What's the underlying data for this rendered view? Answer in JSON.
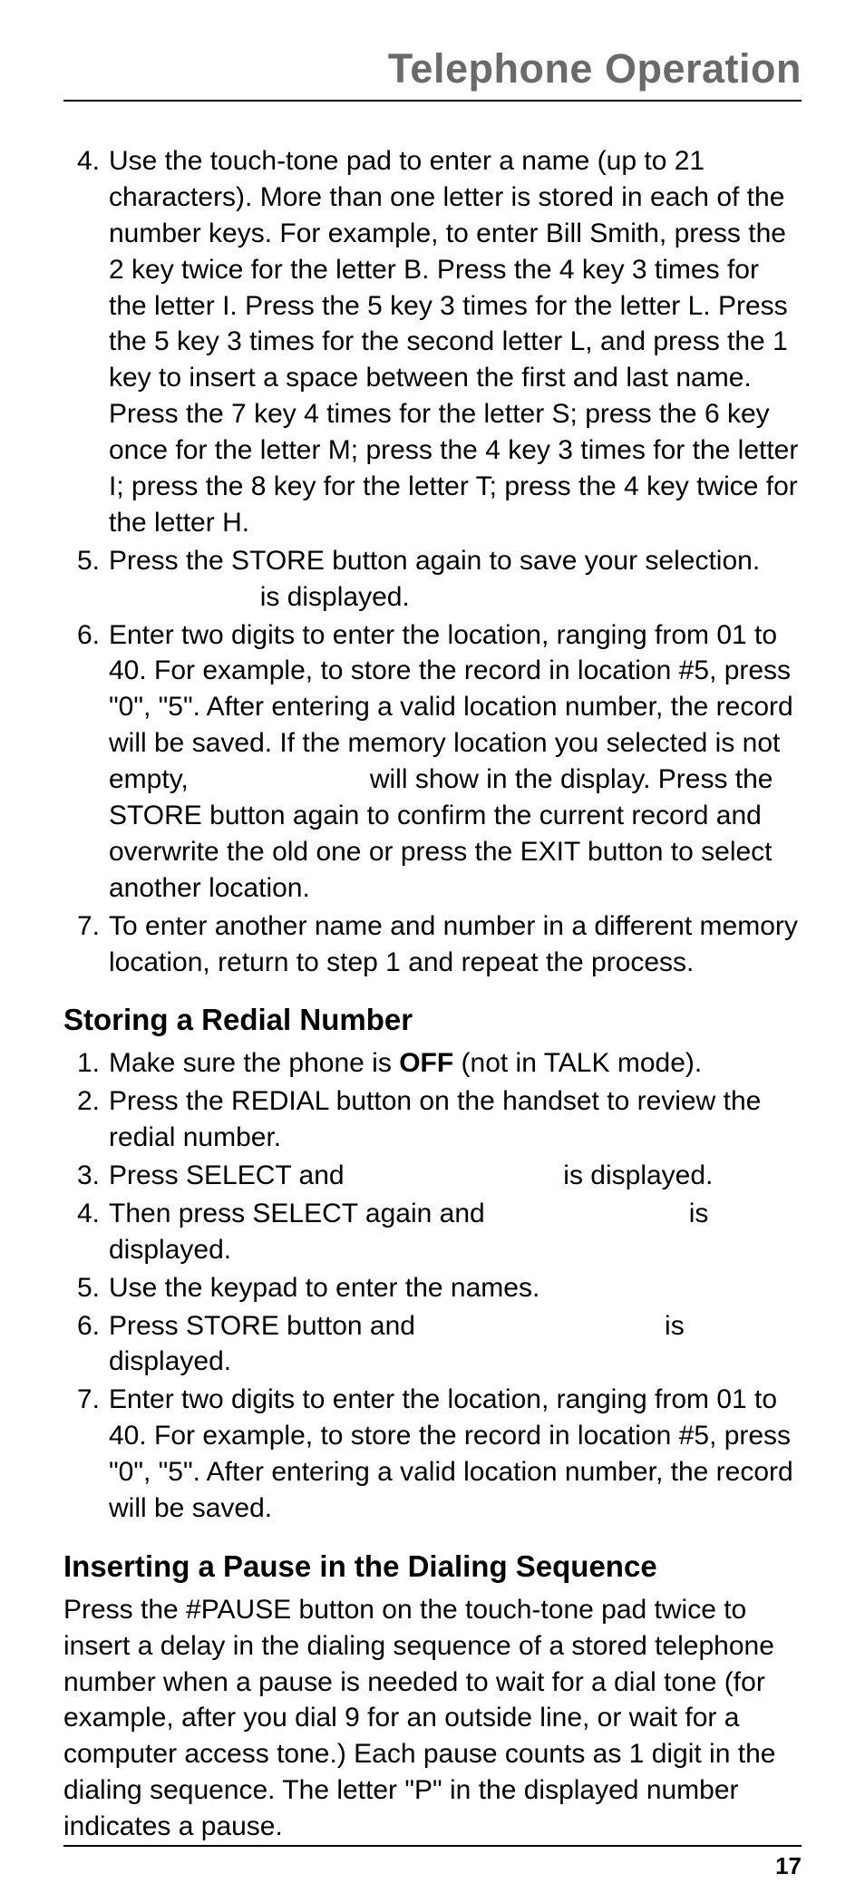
{
  "header": {
    "title": "Telephone Operation"
  },
  "section1": {
    "items": [
      {
        "num": "4.",
        "text": "Use the touch-tone pad to enter a name (up to 21 characters). More than one letter is stored in each of the number keys. For example, to enter Bill Smith, press the 2 key twice for the letter B. Press the 4 key 3 times for the letter I. Press the 5 key 3 times for the letter L. Press the 5 key 3 times for the second letter L, and press the 1 key to insert a space between the first and last name. Press the 7 key 4 times for the letter S; press the 6 key once for the letter M; press the 4 key 3 times for the letter I; press the 8 key for the letter T; press the 4 key twice for the letter H."
      },
      {
        "num": "5.",
        "text_a": "Press the STORE button again to save your selection. ",
        "text_b": " is displayed."
      },
      {
        "num": "6.",
        "text_a": "Enter two digits to enter the location, ranging from 01 to 40. For example, to store the record in location #5, press \"0\", \"5\". After entering a valid location number, the record will be saved. If the memory location you selected is not empty, ",
        "text_b": " will show in the display. Press the STORE button again to confirm the current record and overwrite the old one or press the EXIT button to select another location."
      },
      {
        "num": "7.",
        "text": "To enter another name and number in a different memory location, return to step 1 and repeat the process."
      }
    ]
  },
  "section2": {
    "heading": "Storing a Redial Number",
    "items": [
      {
        "num": "1.",
        "text_a": "Make sure the phone is ",
        "bold": "OFF",
        "text_b": " (not in TALK mode)."
      },
      {
        "num": "2.",
        "text": "Press the REDIAL button on the handset to review the redial number."
      },
      {
        "num": "3.",
        "text_a": "Press SELECT and ",
        "text_b": " is displayed."
      },
      {
        "num": "4.",
        "text_a": "Then press SELECT again and ",
        "text_b": " is displayed."
      },
      {
        "num": "5.",
        "text": "Use the keypad to enter the names."
      },
      {
        "num": "6.",
        "text_a": "Press STORE button and ",
        "text_b": " is displayed."
      },
      {
        "num": "7.",
        "text": "Enter two digits to enter the location, ranging from 01 to 40. For example, to store the record in location #5, press \"0\", \"5\". After entering a valid location number, the record will be saved."
      }
    ]
  },
  "section3": {
    "heading": "Inserting a Pause in the Dialing Sequence",
    "para": "Press the #PAUSE button on the touch-tone pad twice to insert a delay in the dialing sequence of a stored telephone number when a pause is needed to wait for a dial tone (for example, after you dial 9 for an outside line, or wait for a computer access tone.) Each pause counts as 1 digit in the dialing sequence. The letter \"P\" in the displayed number indicates a pause."
  },
  "footer": {
    "page": "17"
  }
}
